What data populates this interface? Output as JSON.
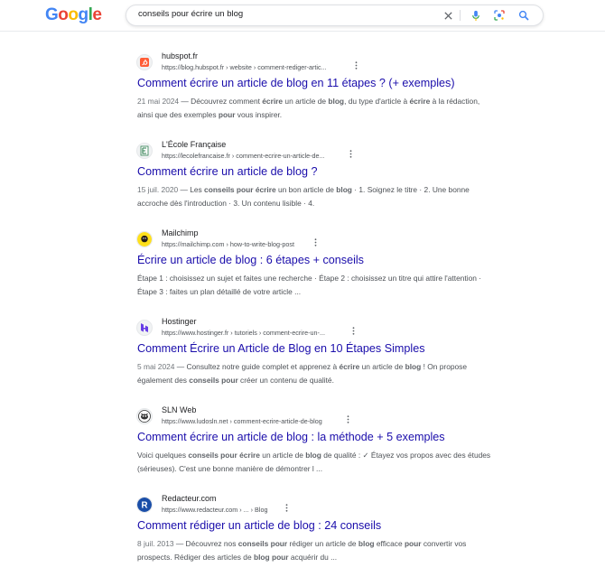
{
  "header": {
    "logo_letters": [
      {
        "ch": "G",
        "color": "#4285F4"
      },
      {
        "ch": "o",
        "color": "#EA4335"
      },
      {
        "ch": "o",
        "color": "#FBBC05"
      },
      {
        "ch": "g",
        "color": "#4285F4"
      },
      {
        "ch": "l",
        "color": "#34A853"
      },
      {
        "ch": "e",
        "color": "#EA4335"
      }
    ],
    "search_query": "conseils pour écrire un blog",
    "icons": [
      "clear-icon",
      "microphone-icon",
      "lens-icon",
      "search-icon"
    ]
  },
  "colors": {
    "title_link": "#1a0dab",
    "snippet": "#4d5156",
    "url": "#4d5156"
  },
  "results": [
    {
      "site_name": "hubspot.fr",
      "url": "https://blog.hubspot.fr › website › comment-rediger-artic...",
      "title": "Comment écrire un article de blog en 11 étapes ? (+ exemples)",
      "date": "21 mai 2024",
      "snippet": [
        {
          "t": "Découvrez comment "
        },
        {
          "b": "écrire"
        },
        {
          "t": " un article de "
        },
        {
          "b": "blog"
        },
        {
          "t": ", du type d'article à "
        },
        {
          "b": "écrire"
        },
        {
          "t": " à la rédaction, ainsi que des exemples "
        },
        {
          "b": "pour"
        },
        {
          "t": " vous inspirer."
        }
      ],
      "favicon": "hubspot-icon"
    },
    {
      "site_name": "L'École Française",
      "url": "https://lecolefrancaise.fr › comment-ecrire-un-article-de...",
      "title": "Comment écrire un article de blog ?",
      "date": "15 juil. 2020",
      "snippet": [
        {
          "t": "Les "
        },
        {
          "b": "conseils pour écrire"
        },
        {
          "t": " un bon article de "
        },
        {
          "b": "blog"
        },
        {
          "t": " · 1. Soignez le titre · 2. Une bonne accroche dès l'introduction · 3. Un contenu lisible · 4."
        }
      ],
      "favicon": "ecole-francaise-icon"
    },
    {
      "site_name": "Mailchimp",
      "url": "https://mailchimp.com › how-to-write-blog-post",
      "title": "Écrire un article de blog : 6 étapes + conseils",
      "date": "",
      "snippet": [
        {
          "t": "Étape 1 : choisissez un sujet et faites une recherche · Étape 2 : choisissez un titre qui attire l'attention · Étape 3 : faites un plan détaillé de votre article ..."
        }
      ],
      "favicon": "mailchimp-icon"
    },
    {
      "site_name": "Hostinger",
      "url": "https://www.hostinger.fr › tutoriels › comment-ecrire-un-...",
      "title": "Comment Écrire un Article de Blog en 10 Étapes Simples",
      "date": "5 mai 2024",
      "snippet": [
        {
          "t": "Consultez notre guide complet et apprenez à "
        },
        {
          "b": "écrire"
        },
        {
          "t": " un article de "
        },
        {
          "b": "blog"
        },
        {
          "t": " ! On propose également des "
        },
        {
          "b": "conseils pour"
        },
        {
          "t": " créer un contenu de qualité."
        }
      ],
      "favicon": "hostinger-icon"
    },
    {
      "site_name": "SLN Web",
      "url": "https://www.ludosln.net › comment-ecrire-article-de-blog",
      "title": "Comment écrire un article de blog : la méthode + 5 exemples",
      "date": "",
      "snippet": [
        {
          "t": "Voici quelques "
        },
        {
          "b": "conseils pour écrire"
        },
        {
          "t": " un article de "
        },
        {
          "b": "blog"
        },
        {
          "t": " de qualité : ✓ Étayez vos propos avec des études (sérieuses). C'est une bonne manière de démontrer l ..."
        }
      ],
      "favicon": "sln-web-icon"
    },
    {
      "site_name": "Redacteur.com",
      "url": "https://www.redacteur.com › ... › Blog",
      "title": "Comment rédiger un article de blog : 24 conseils",
      "date": "8 juil. 2013",
      "snippet": [
        {
          "t": "Découvrez nos "
        },
        {
          "b": "conseils pour"
        },
        {
          "t": " rédiger un article de "
        },
        {
          "b": "blog"
        },
        {
          "t": " efficace "
        },
        {
          "b": "pour"
        },
        {
          "t": " convertir vos prospects. Rédiger des articles de "
        },
        {
          "b": "blog pour"
        },
        {
          "t": " acquérir du ..."
        }
      ],
      "favicon": "redacteur-icon"
    }
  ]
}
